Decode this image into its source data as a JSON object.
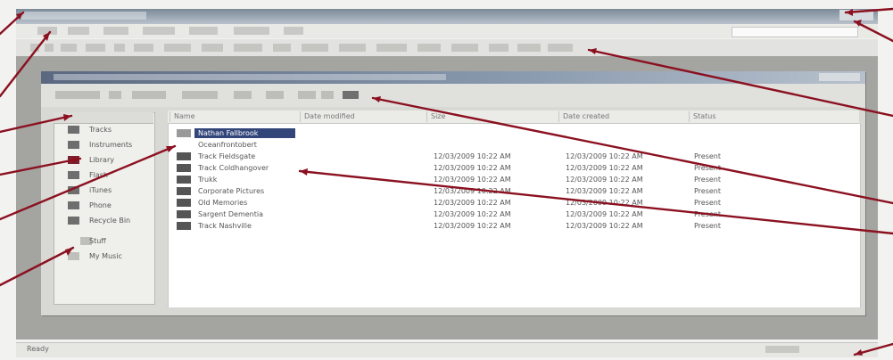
{
  "window": {
    "title": ""
  },
  "menu": {
    "items": [
      "File",
      "Edit",
      "View",
      "Content",
      "Group",
      "Options",
      "Help"
    ]
  },
  "left_pane": {
    "items": [
      {
        "label": "Tracks",
        "icon": "tracks-icon"
      },
      {
        "label": "Instruments",
        "icon": "instruments-icon"
      },
      {
        "label": "Library",
        "icon": "library-icon"
      },
      {
        "label": "Flash",
        "icon": "flash-icon"
      },
      {
        "label": "iTunes",
        "icon": "itunes-icon"
      },
      {
        "label": "Phone",
        "icon": "phone-icon"
      },
      {
        "label": "Recycle Bin",
        "icon": "recycle-bin-icon"
      },
      {
        "label": "Stuff",
        "icon": "folder-icon"
      },
      {
        "label": "My Music",
        "icon": "music-icon"
      }
    ]
  },
  "list": {
    "columns": [
      "Name",
      "Date modified",
      "Size",
      "Date created",
      "Status"
    ],
    "rows": [
      {
        "name": "Nathan Fallbrook",
        "modified": "",
        "created": "",
        "status": "",
        "selected": true
      },
      {
        "name": "Oceanfrontobert",
        "modified": "",
        "created": "",
        "status": ""
      },
      {
        "name": "Track Fieldsgate",
        "modified": "12/03/2009 10:22 AM",
        "created": "12/03/2009 10:22 AM",
        "status": "Present"
      },
      {
        "name": "Track Coldhangover",
        "modified": "12/03/2009 10:22 AM",
        "created": "12/03/2009 10:22 AM",
        "status": "Present"
      },
      {
        "name": "Trukk",
        "modified": "12/03/2009 10:22 AM",
        "created": "12/03/2009 10:22 AM",
        "status": "Present"
      },
      {
        "name": "Corporate Pictures",
        "modified": "12/03/2009 10:22 AM",
        "created": "12/03/2009 10:22 AM",
        "status": "Present"
      },
      {
        "name": "Old Memories",
        "modified": "12/03/2009 10:22 AM",
        "created": "12/03/2009 10:22 AM",
        "status": "Present"
      },
      {
        "name": "Sargent Dementia",
        "modified": "12/03/2009 10:22 AM",
        "created": "12/03/2009 10:22 AM",
        "status": "Present"
      },
      {
        "name": "Track Nashville",
        "modified": "12/03/2009 10:22 AM",
        "created": "12/03/2009 10:22 AM",
        "status": "Present"
      }
    ]
  },
  "status": {
    "text": "Ready"
  },
  "colors": {
    "selection": "#33467a",
    "arrow": "#8b1020",
    "mdi_background": "#a4a4a0"
  }
}
